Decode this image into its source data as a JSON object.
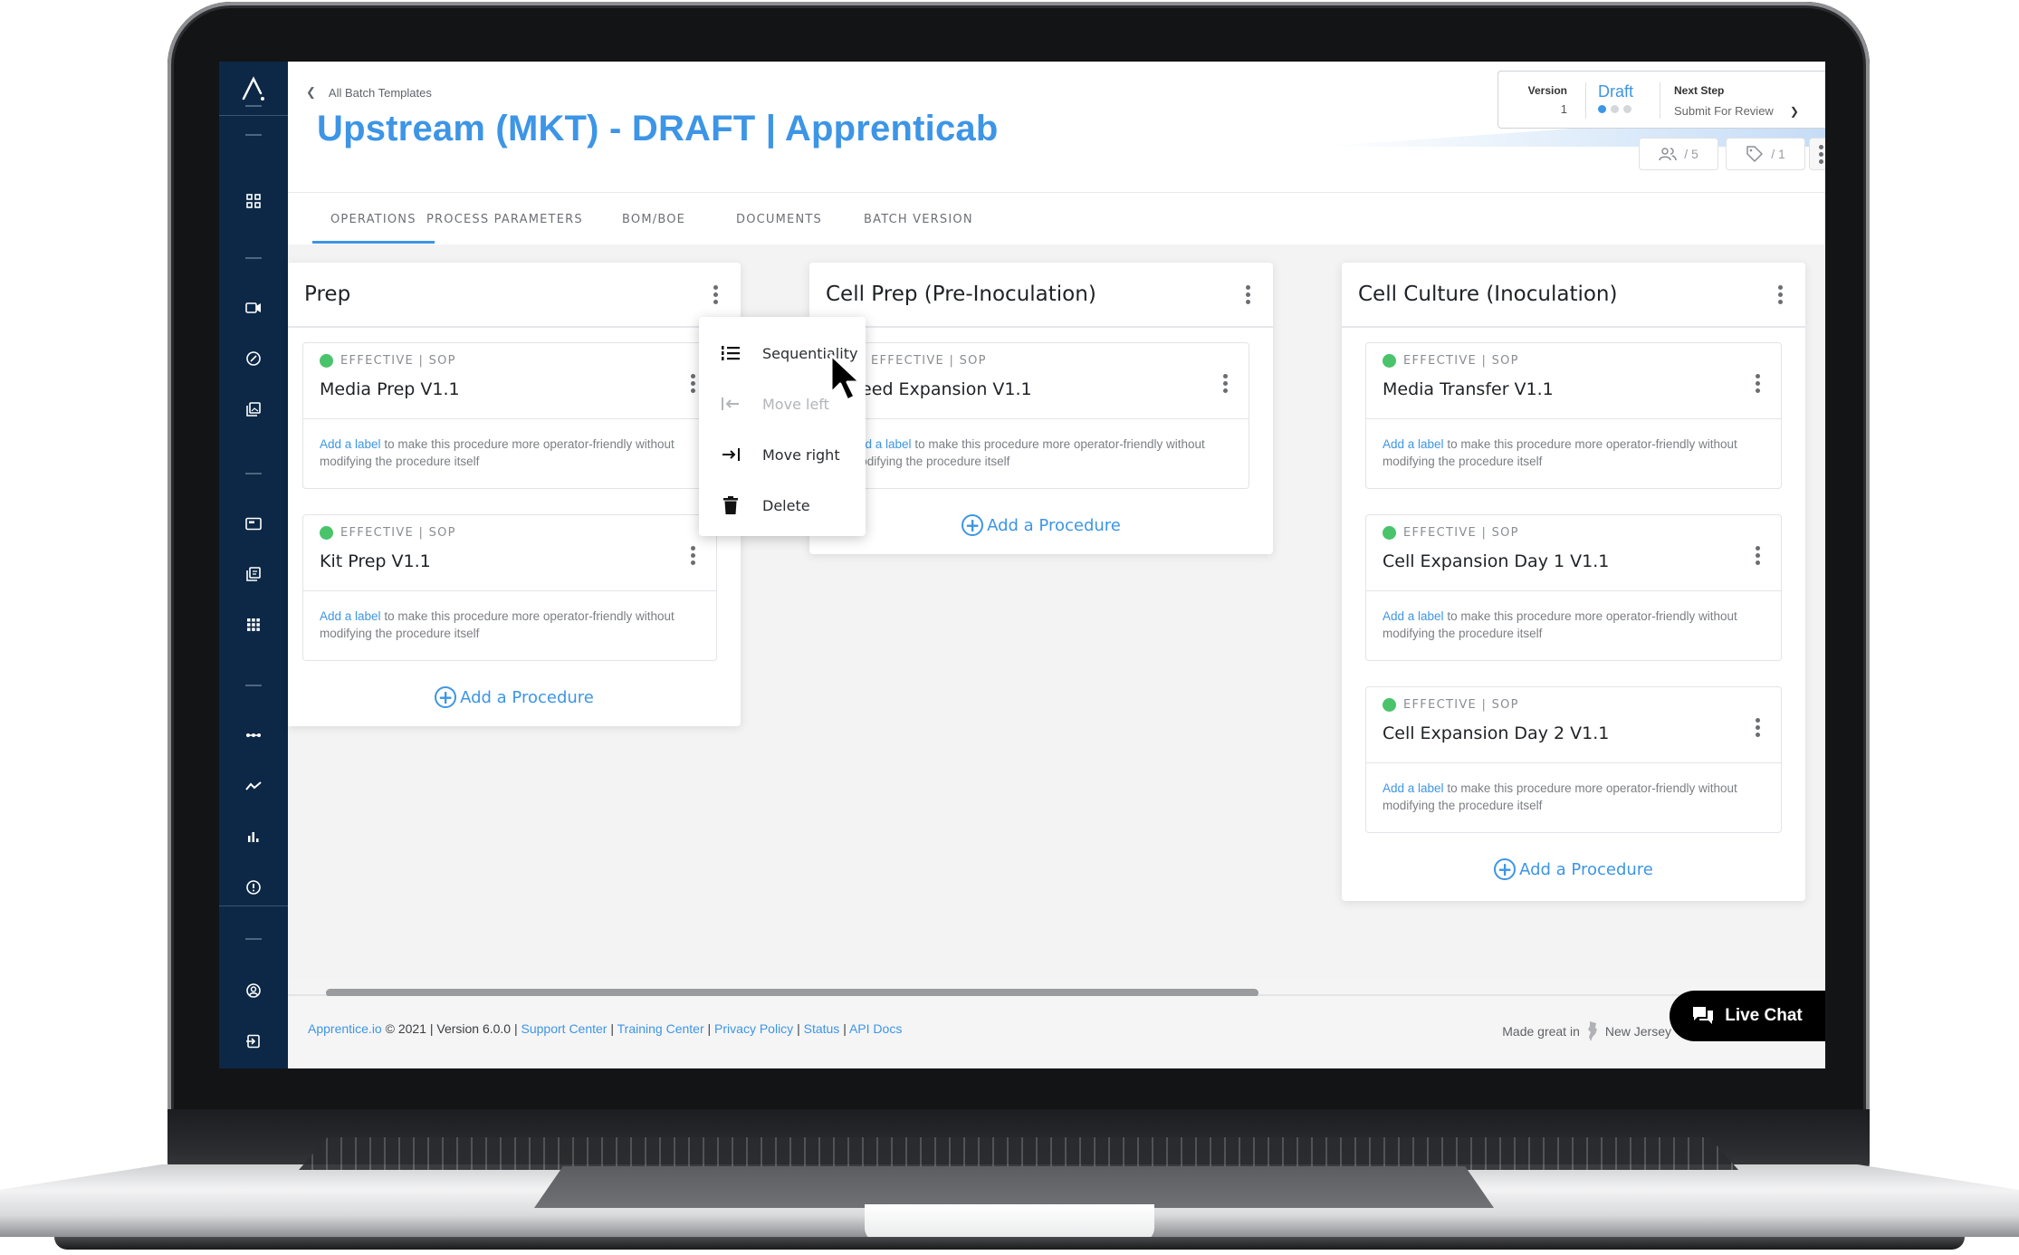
{
  "sidebar": {
    "logo": "Apprentice logo",
    "items": [
      {
        "icon": "dashboard-icon"
      },
      {
        "icon": "video-camera-icon"
      },
      {
        "icon": "gauge-icon"
      },
      {
        "icon": "image-gallery-icon"
      },
      {
        "icon": "card-icon"
      },
      {
        "icon": "documents-icon"
      },
      {
        "icon": "apps-grid-icon"
      },
      {
        "icon": "timeline-icon"
      },
      {
        "icon": "trend-line-icon"
      },
      {
        "icon": "bar-chart-icon"
      },
      {
        "icon": "alert-icon"
      },
      {
        "icon": "account-icon"
      },
      {
        "icon": "logout-icon"
      }
    ]
  },
  "header": {
    "breadcrumb": "All Batch Templates",
    "title": "Upstream (MKT) - DRAFT | Apprenticab",
    "status": {
      "version_label": "Version",
      "version_value": "1",
      "state": "Draft",
      "state_step": 1,
      "state_steps_total": 3,
      "next_step_label": "Next Step",
      "next_step_value": "Submit For Review"
    },
    "users_count": "/ 5",
    "tags_count": "/ 1"
  },
  "tabs": [
    {
      "label": "OPERATIONS",
      "active": true
    },
    {
      "label": "PROCESS PARAMETERS",
      "active": false
    },
    {
      "label": "BOM/BOE",
      "active": false
    },
    {
      "label": "DOCUMENTS",
      "active": false
    },
    {
      "label": "BATCH VERSION",
      "active": false
    }
  ],
  "columns": [
    {
      "title": "Prep",
      "procedures": [
        {
          "status": "EFFECTIVE | SOP",
          "name": "Media Prep V1.1",
          "label_link": "Add a label",
          "label_text": "to make this procedure more operator-friendly without modifying the procedure itself"
        },
        {
          "status": "EFFECTIVE | SOP",
          "name": "Kit Prep V1.1",
          "label_link": "Add a label",
          "label_text": "to make this procedure more operator-friendly without modifying the procedure itself"
        }
      ],
      "add_label": "Add a Procedure"
    },
    {
      "title": "Cell Prep (Pre-Inoculation)",
      "procedures": [
        {
          "status": "EFFECTIVE | SOP",
          "name": "Seed Expansion V1.1",
          "label_link": "Add a label",
          "label_text": "to make this procedure more operator-friendly without modifying the procedure itself"
        }
      ],
      "add_label": "Add a Procedure"
    },
    {
      "title": "Cell Culture (Inoculation)",
      "procedures": [
        {
          "status": "EFFECTIVE | SOP",
          "name": "Media Transfer V1.1",
          "label_link": "Add a label",
          "label_text": "to make this procedure more operator-friendly without modifying the procedure itself"
        },
        {
          "status": "EFFECTIVE | SOP",
          "name": "Cell Expansion Day 1 V1.1",
          "label_link": "Add a label",
          "label_text": "to make this procedure more operator-friendly without modifying the procedure itself"
        },
        {
          "status": "EFFECTIVE | SOP",
          "name": "Cell Expansion Day 2 V1.1",
          "label_link": "Add a label",
          "label_text": "to make this procedure more operator-friendly without modifying the procedure itself"
        }
      ],
      "add_label": "Add a Procedure"
    }
  ],
  "context_menu": {
    "items": [
      {
        "label": "Sequentiality",
        "icon": "numbered-list-icon",
        "disabled": false
      },
      {
        "label": "Move left",
        "icon": "move-left-icon",
        "disabled": true
      },
      {
        "label": "Move right",
        "icon": "move-right-icon",
        "disabled": false
      },
      {
        "label": "Delete",
        "icon": "trash-icon",
        "disabled": false
      }
    ]
  },
  "footer": {
    "brand": "Apprentice.io",
    "copyright": " © 2021 | Version 6.0.0 | ",
    "links": [
      "Support Center",
      "Training Center",
      "Privacy Policy",
      "Status",
      "API Docs"
    ],
    "made_in_prefix": "Made great in",
    "made_in_place": "New Jersey"
  },
  "live_chat": {
    "label": "Live Chat"
  },
  "colors": {
    "accent": "#3d95e6",
    "sidebar": "#0c2846",
    "effective": "#49c46b"
  }
}
